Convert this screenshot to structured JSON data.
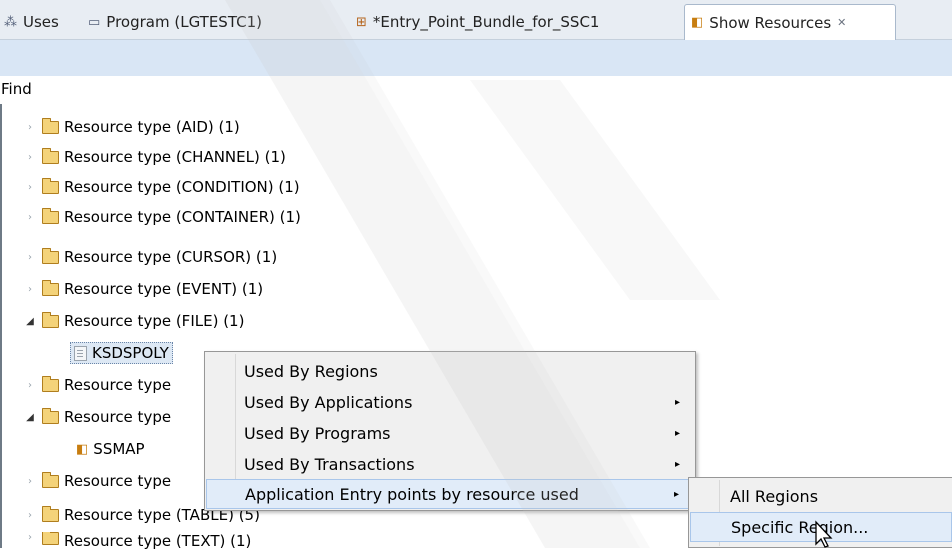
{
  "tabs": [
    {
      "label": "Uses",
      "icon": "uses-icon"
    },
    {
      "label": "Program (LGTESTC1)",
      "icon": "window-icon"
    },
    {
      "label": "*Entry_Point_Bundle_for_SSC1",
      "icon": "bundle-icon"
    },
    {
      "label": "Show Resources",
      "icon": "resources-icon",
      "close": "✕"
    }
  ],
  "find_label": "Find",
  "tree": [
    {
      "label": "Resource type (AID)  (1)"
    },
    {
      "label": "Resource type (CHANNEL)  (1)"
    },
    {
      "label": "Resource type (CONDITION)  (1)"
    },
    {
      "label": "Resource type (CONTAINER)  (1)"
    },
    {
      "label": "Resource type (CURSOR)  (1)"
    },
    {
      "label": "Resource type (EVENT)  (1)"
    },
    {
      "label": "Resource type (FILE)  (1)"
    },
    {
      "label": "KSDSPOLY"
    },
    {
      "label": "Resource type"
    },
    {
      "label": "Resource type"
    },
    {
      "label": "SSMAP"
    },
    {
      "label": "Resource type"
    },
    {
      "label": "Resource type (TABLE)  (5)"
    },
    {
      "label": "Resource type (TEXT)  (1)"
    }
  ],
  "context_menu": {
    "items": [
      {
        "label": "Used By Regions"
      },
      {
        "label": "Used By Applications",
        "submenu": "▸"
      },
      {
        "label": "Used By Programs",
        "submenu": "▸"
      },
      {
        "label": "Used By Transactions",
        "submenu": "▸"
      },
      {
        "label": "Application Entry points by resource used",
        "submenu": "▸"
      }
    ]
  },
  "submenu": {
    "items": [
      {
        "label": "All Regions"
      },
      {
        "label": "Specific Region..."
      }
    ]
  },
  "colors": {
    "tab_bar": "#e8edf3",
    "toolbar_strip": "#d9e6f5",
    "menu_bg": "#f0f0f0",
    "menu_highlight": "#e1ecf9",
    "folder": "#f4d37a"
  }
}
